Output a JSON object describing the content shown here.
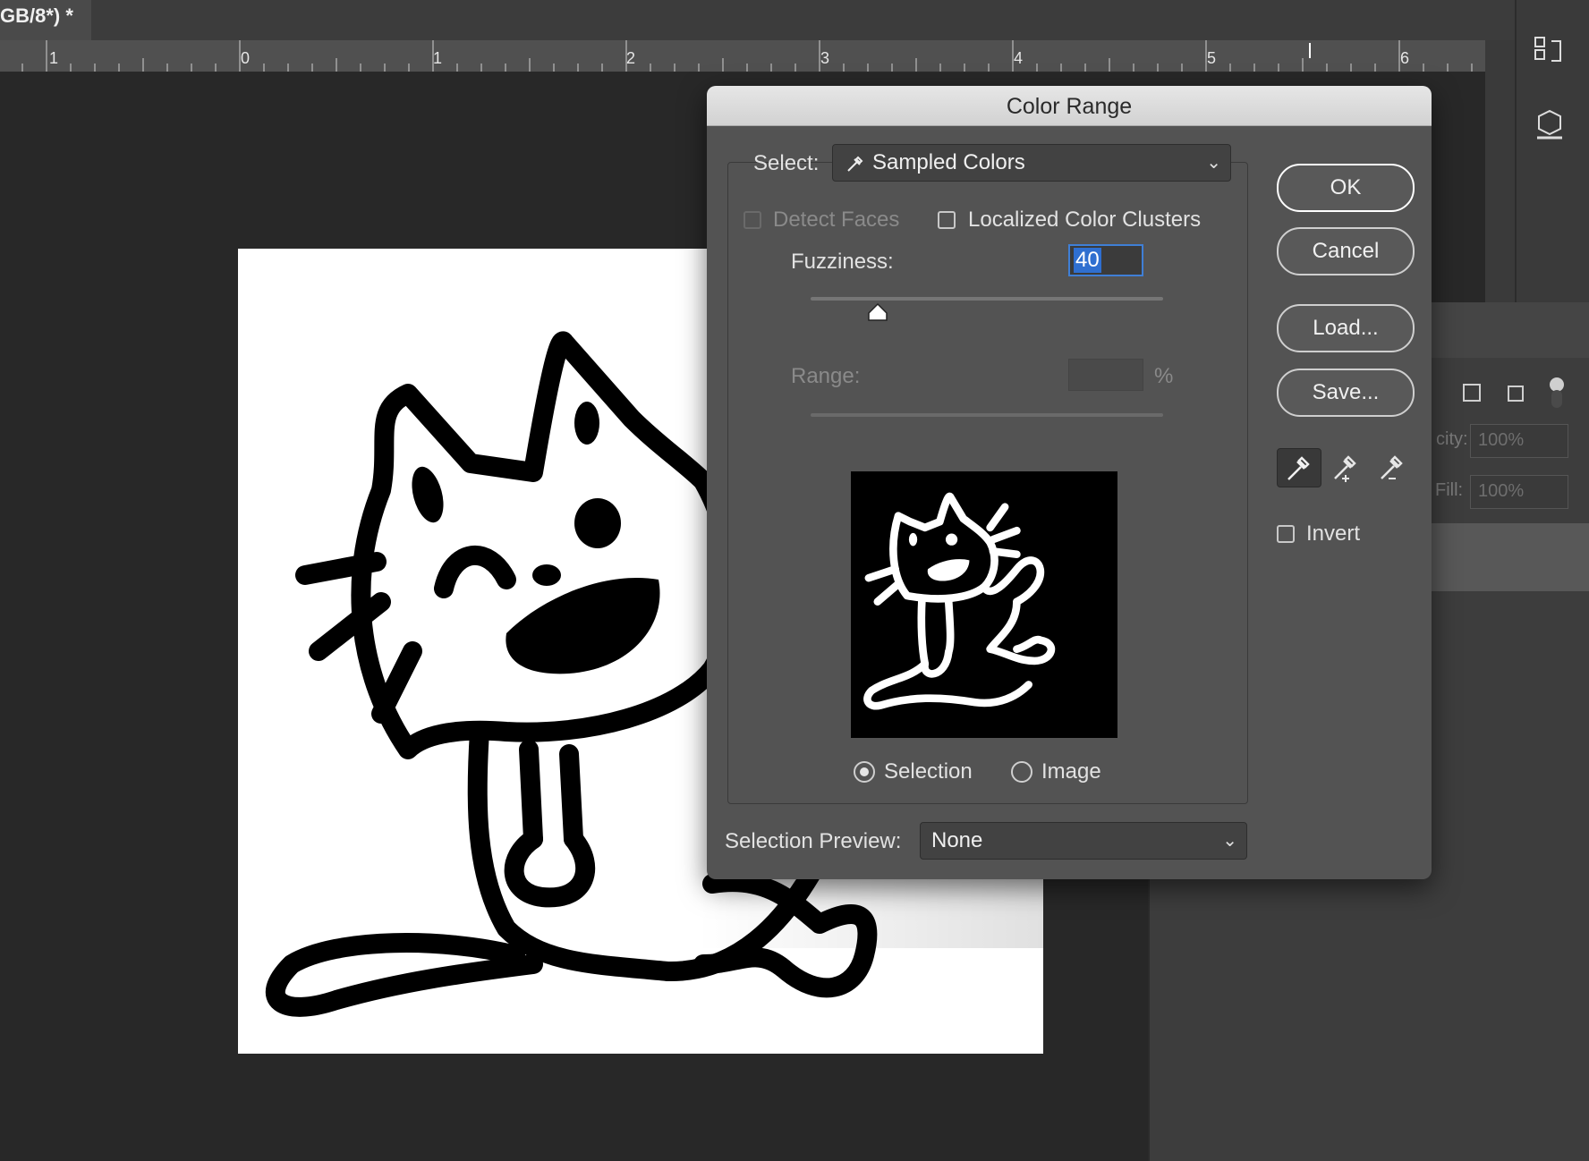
{
  "document": {
    "tab_title": "GB/8*) *"
  },
  "ruler": {
    "labels": [
      "1",
      "0",
      "1",
      "2",
      "3",
      "4",
      "5",
      "6"
    ]
  },
  "layers_panel": {
    "opacity_label": "city:",
    "opacity_value": "100%",
    "fill_label": "Fill:",
    "fill_value": "100%"
  },
  "dialog": {
    "title": "Color Range",
    "select_label": "Select:",
    "select_value": "Sampled Colors",
    "detect_faces_label": "Detect Faces",
    "localized_clusters_label": "Localized Color Clusters",
    "fuzziness_label": "Fuzziness:",
    "fuzziness_value": "40",
    "fuzziness_level": 0.19,
    "range_label": "Range:",
    "range_value": "",
    "range_unit": "%",
    "view_selection_label": "Selection",
    "view_image_label": "Image",
    "view_selected": "Selection",
    "selection_preview_label": "Selection Preview:",
    "selection_preview_value": "None",
    "buttons": {
      "ok": "OK",
      "cancel": "Cancel",
      "load": "Load...",
      "save": "Save..."
    },
    "invert_label": "Invert",
    "eyedroppers": [
      "eyedropper-icon",
      "eyedropper-plus-icon",
      "eyedropper-minus-icon"
    ]
  },
  "colors": {
    "accent": "#2f6fd0",
    "dialog_bg": "#535353",
    "canvas_bg": "#282828"
  }
}
